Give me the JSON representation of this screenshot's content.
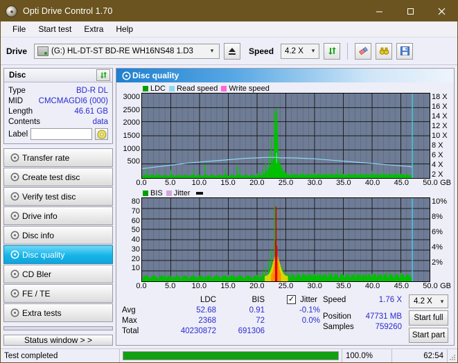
{
  "window": {
    "title": "Opti Drive Control 1.70",
    "icon": "disc-icon",
    "minimize": "minimize-icon",
    "maximize": "maximize-icon",
    "close": "close-icon"
  },
  "menu": {
    "items": [
      "File",
      "Start test",
      "Extra",
      "Help"
    ]
  },
  "toolbar": {
    "drive_label": "Drive",
    "drive_value": "(G:)  HL-DT-ST BD-RE  WH16NS48 1.D3",
    "eject_icon": "eject-icon",
    "speed_label": "Speed",
    "speed_value": "4.2 X",
    "refresh_icon": "refresh-icon",
    "erase_icon": "eraser-icon",
    "inspect_icon": "binoculars-icon",
    "save_icon": "save-icon"
  },
  "disc_panel": {
    "title": "Disc",
    "refresh_icon": "refresh-icon",
    "rows": [
      {
        "key": "Type",
        "value": "BD-R DL"
      },
      {
        "key": "MID",
        "value": "CMCMAGDI6 (000)"
      },
      {
        "key": "Length",
        "value": "46.61 GB"
      },
      {
        "key": "Contents",
        "value": "data"
      }
    ],
    "label_key": "Label",
    "label_value": "",
    "disc_icon": "cd-icon"
  },
  "sidebar": {
    "items": [
      {
        "label": "Transfer rate",
        "icon": "disc-icon",
        "active": false
      },
      {
        "label": "Create test disc",
        "icon": "disc-icon",
        "active": false
      },
      {
        "label": "Verify test disc",
        "icon": "disc-icon",
        "active": false
      },
      {
        "label": "Drive info",
        "icon": "disc-icon",
        "active": false
      },
      {
        "label": "Disc info",
        "icon": "disc-icon",
        "active": false
      },
      {
        "label": "Disc quality",
        "icon": "disc-icon",
        "active": true
      },
      {
        "label": "CD Bler",
        "icon": "disc-icon",
        "active": false
      },
      {
        "label": "FE / TE",
        "icon": "disc-icon",
        "active": false
      },
      {
        "label": "Extra tests",
        "icon": "disc-icon",
        "active": false
      }
    ],
    "status_window_button": "Status window > >"
  },
  "content": {
    "header_title": "Disc quality",
    "header_icon": "disc-icon"
  },
  "chart_data": [
    {
      "type": "line",
      "name": "top-chart-ldc",
      "title": "",
      "legend": [
        {
          "label": "LDC",
          "color": "#00a000"
        },
        {
          "label": "Read speed",
          "color": "#8fd8f2"
        },
        {
          "label": "Write speed",
          "color": "#ff66d9"
        }
      ],
      "legend_position": "top-left",
      "xlabel": "GB",
      "x_unit": "GB",
      "xlim": [
        0,
        50
      ],
      "xticks": [
        "0.0",
        "5.0",
        "10.0",
        "15.0",
        "20.0",
        "25.0",
        "30.0",
        "35.0",
        "40.0",
        "45.0",
        "50.0"
      ],
      "ylabel": "",
      "ylim": [
        0,
        3000
      ],
      "yticks": [
        "3000",
        "2500",
        "2000",
        "1500",
        "1000",
        "500"
      ],
      "y2label": "X",
      "y2lim": [
        0,
        18
      ],
      "y2ticks": [
        "18 X",
        "16 X",
        "14 X",
        "12 X",
        "10 X",
        "8 X",
        "6 X",
        "4 X",
        "2 X"
      ],
      "grid": true,
      "series": [
        {
          "name": "LDC",
          "color": "#00c000",
          "x": [
            0.0,
            0.5,
            1.0,
            1.5,
            2.0,
            2.5,
            3.0,
            3.5,
            4.0,
            4.5,
            5.0,
            5.5,
            6.0,
            6.5,
            7.0,
            7.5,
            8.0,
            8.5,
            9.0,
            9.5,
            10.0,
            10.5,
            11.0,
            11.5,
            12.0,
            12.5,
            13.0,
            13.5,
            14.0,
            14.5,
            15.0,
            15.5,
            16.0,
            16.5,
            17.0,
            17.5,
            18.0,
            18.5,
            19.0,
            19.5,
            20.0,
            20.5,
            21.0,
            21.5,
            22.0,
            22.5,
            23.0,
            23.3,
            23.6,
            24.0,
            24.5,
            25.0,
            25.5,
            26.0,
            26.5,
            27.0,
            27.5,
            28.0,
            28.5,
            29.0,
            29.5,
            30.0,
            30.5,
            31.0,
            31.5,
            32.0,
            32.5,
            33.0,
            33.5,
            34.0,
            34.5,
            35.0,
            35.5,
            36.0,
            36.5,
            37.0,
            37.5,
            38.0,
            38.5,
            39.0,
            39.5,
            40.0,
            40.5,
            41.0,
            41.5,
            42.0,
            42.5,
            43.0,
            43.5,
            44.0,
            44.5,
            45.0,
            45.5,
            46.0,
            46.5,
            47.0
          ],
          "values": [
            60,
            40,
            380,
            55,
            45,
            200,
            50,
            45,
            60,
            40,
            300,
            55,
            45,
            50,
            60,
            40,
            55,
            50,
            330,
            45,
            60,
            50,
            480,
            55,
            45,
            60,
            50,
            55,
            40,
            350,
            60,
            50,
            45,
            420,
            380,
            55,
            60,
            50,
            45,
            55,
            160,
            240,
            330,
            520,
            900,
            1400,
            2368,
            1100,
            700,
            420,
            260,
            180,
            150,
            170,
            130,
            160,
            140,
            200,
            150,
            170,
            140,
            180,
            150,
            160,
            140,
            190,
            150,
            170,
            150,
            330,
            200,
            150,
            140,
            160,
            150,
            170,
            150,
            180,
            150,
            160,
            150,
            260,
            150,
            170,
            150,
            240,
            150,
            160,
            170,
            150,
            260,
            150,
            140,
            120,
            90
          ]
        },
        {
          "name": "Read speed",
          "color": "#8fd8f2",
          "x": [
            0,
            2,
            4,
            6,
            8,
            10,
            12,
            14,
            16,
            18,
            20,
            22,
            23.5,
            24,
            26,
            28,
            30,
            32,
            34,
            36,
            38,
            40,
            42,
            44,
            46,
            47
          ],
          "values": [
            2.0,
            2.3,
            2.6,
            2.9,
            3.2,
            3.4,
            3.6,
            3.8,
            4.0,
            4.2,
            4.3,
            4.4,
            4.4,
            4.3,
            4.3,
            4.2,
            4.1,
            3.9,
            3.7,
            3.5,
            3.3,
            3.1,
            2.9,
            2.7,
            2.5,
            2.4
          ]
        }
      ],
      "markers": [
        {
          "type": "vline",
          "x": 47.0,
          "color": "#3fd0f8"
        }
      ]
    },
    {
      "type": "line",
      "name": "bottom-chart-bis",
      "title": "",
      "legend": [
        {
          "label": "BIS",
          "color": "#00a000"
        },
        {
          "label": "Jitter",
          "color": "#d0a8d8"
        }
      ],
      "legend_position": "top-left",
      "xlabel": "GB",
      "x_unit": "GB",
      "xlim": [
        0,
        50
      ],
      "xticks": [
        "0.0",
        "5.0",
        "10.0",
        "15.0",
        "20.0",
        "25.0",
        "30.0",
        "35.0",
        "40.0",
        "45.0",
        "50.0"
      ],
      "ylabel": "",
      "ylim": [
        0,
        80
      ],
      "yticks": [
        "80",
        "70",
        "60",
        "50",
        "40",
        "30",
        "20",
        "10"
      ],
      "y2label": "%",
      "y2lim": [
        0,
        10
      ],
      "y2ticks": [
        "10%",
        "8%",
        "6%",
        "4%",
        "2%"
      ],
      "grid": true,
      "series": [
        {
          "name": "BIS",
          "color": "#00c000",
          "x": [
            0.0,
            0.5,
            1.0,
            1.5,
            2.0,
            2.5,
            3.0,
            3.5,
            4.0,
            4.5,
            5.0,
            5.5,
            6.0,
            6.5,
            7.0,
            7.5,
            8.0,
            8.5,
            9.0,
            9.5,
            10.0,
            10.5,
            11.0,
            11.5,
            12.0,
            12.5,
            13.0,
            13.5,
            14.0,
            14.5,
            15.0,
            15.5,
            16.0,
            16.5,
            17.0,
            17.5,
            18.0,
            18.5,
            19.0,
            19.5,
            20.0,
            20.5,
            21.0,
            21.5,
            22.0,
            22.5,
            23.0,
            23.3,
            23.6,
            24.0,
            24.5,
            25.0,
            25.5,
            26.0,
            26.5,
            27.0,
            27.5,
            28.0,
            28.5,
            29.0,
            29.5,
            30.0,
            30.5,
            31.0,
            31.5,
            32.0,
            32.5,
            33.0,
            33.5,
            34.0,
            34.5,
            35.0,
            35.5,
            36.0,
            36.5,
            37.0,
            37.5,
            38.0,
            38.5,
            39.0,
            39.5,
            40.0,
            40.5,
            41.0,
            41.5,
            42.0,
            42.5,
            43.0,
            43.5,
            44.0,
            44.5,
            45.0,
            45.5,
            46.0,
            46.5,
            47.0
          ],
          "values": [
            2,
            3,
            4,
            3,
            2,
            4,
            3,
            2,
            7,
            5,
            3,
            4,
            3,
            4,
            5,
            3,
            4,
            3,
            6,
            4,
            3,
            4,
            5,
            3,
            4,
            3,
            4,
            5,
            3,
            4,
            6,
            3,
            4,
            5,
            4,
            3,
            4,
            5,
            3,
            4,
            6,
            8,
            10,
            14,
            20,
            30,
            72,
            34,
            22,
            16,
            12,
            9,
            7,
            8,
            6,
            7,
            6,
            8,
            7,
            6,
            7,
            6,
            8,
            6,
            7,
            6,
            9,
            7,
            8,
            6,
            7,
            6,
            8,
            6,
            7,
            6,
            8,
            7,
            6,
            7,
            6,
            7,
            8,
            6,
            7,
            6,
            9,
            7,
            6,
            7,
            6,
            8,
            6,
            5,
            4,
            3
          ]
        },
        {
          "name": "Jitter",
          "color": "#d0a8d8",
          "x": [],
          "values": []
        }
      ],
      "markers": [
        {
          "type": "vline",
          "x": 47.0,
          "color": "#3fd0f8"
        }
      ]
    }
  ],
  "stats": {
    "headers": {
      "col1": "LDC",
      "col2": "BIS",
      "jitter": "Jitter"
    },
    "jitter_checked": true,
    "rows": [
      {
        "label": "Avg",
        "ldc": "52.68",
        "bis": "0.91",
        "jitter": "-0.1%"
      },
      {
        "label": "Max",
        "ldc": "2368",
        "bis": "72",
        "jitter": "0.0%"
      },
      {
        "label": "Total",
        "ldc": "40230872",
        "bis": "691306",
        "jitter": ""
      }
    ],
    "speed_label": "Speed",
    "speed_value": "1.76 X",
    "position_label": "Position",
    "position_value": "47731 MB",
    "samples_label": "Samples",
    "samples_value": "759260",
    "speed_select": "4.2 X",
    "start_full": "Start full",
    "start_part": "Start part"
  },
  "statusbar": {
    "message": "Test completed",
    "progress_percent": 100,
    "percent_text": "100.0%",
    "time": "62:54",
    "progress_color": "#12a012"
  }
}
